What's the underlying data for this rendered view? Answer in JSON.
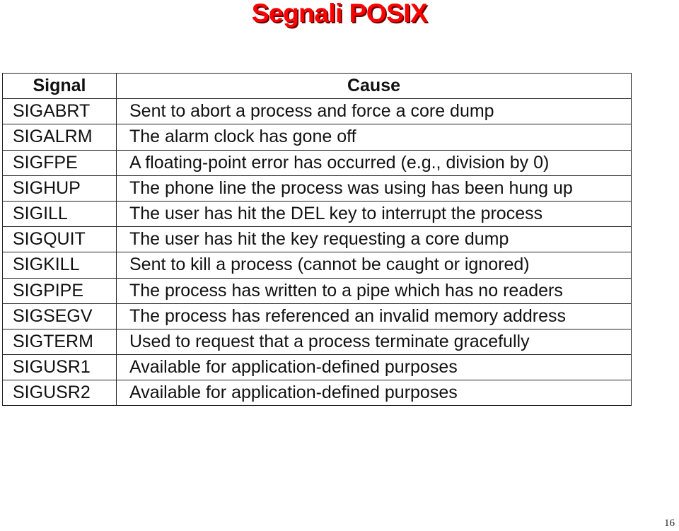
{
  "title": "Segnali POSIX",
  "table": {
    "headers": [
      "Signal",
      "Cause"
    ],
    "rows": [
      [
        "SIGABRT",
        "Sent to abort a process and force a core dump"
      ],
      [
        "SIGALRM",
        "The alarm clock has gone off"
      ],
      [
        "SIGFPE",
        "A floating-point error has occurred (e.g., division by 0)"
      ],
      [
        "SIGHUP",
        "The phone line the process was using has been hung up"
      ],
      [
        "SIGILL",
        "The user has hit the DEL key to interrupt the process"
      ],
      [
        "SIGQUIT",
        "The user has hit the key requesting a core dump"
      ],
      [
        "SIGKILL",
        "Sent to kill a process (cannot be caught or ignored)"
      ],
      [
        "SIGPIPE",
        "The process has written to a pipe which has no readers"
      ],
      [
        "SIGSEGV",
        "The process has referenced an invalid memory address"
      ],
      [
        "SIGTERM",
        "Used to request that a process terminate gracefully"
      ],
      [
        "SIGUSR1",
        "Available for application-defined purposes"
      ],
      [
        "SIGUSR2",
        "Available for application-defined purposes"
      ]
    ]
  },
  "page_number": "16",
  "colors": {
    "title": "#ff0000",
    "title_shadow": "#6b0000"
  }
}
